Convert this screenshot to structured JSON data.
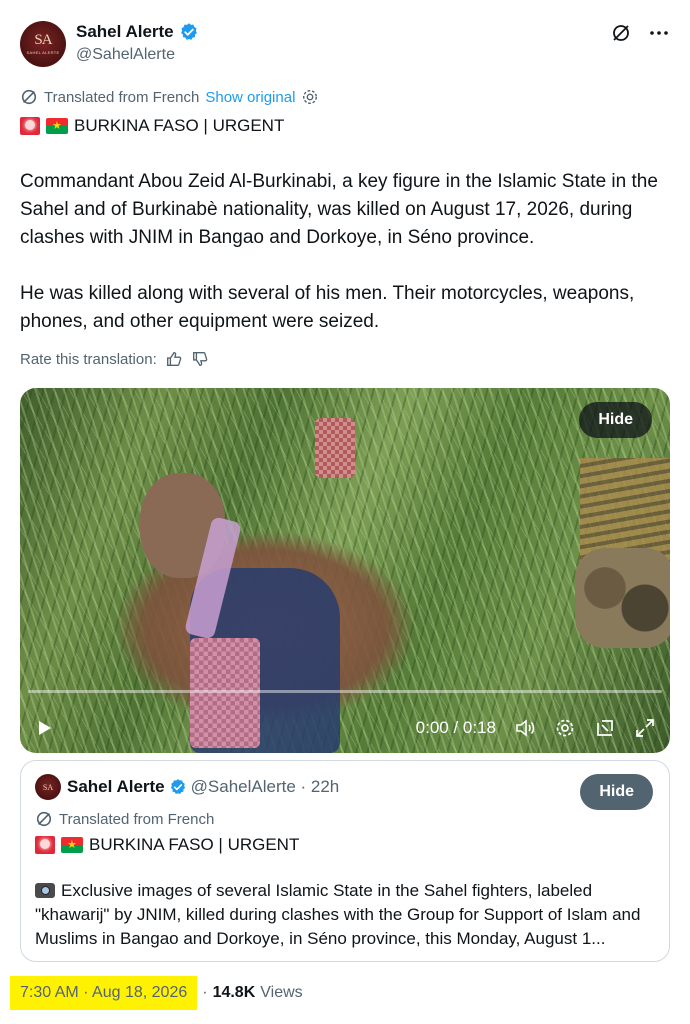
{
  "author": {
    "display_name": "Sahel Alerte",
    "handle": "@SahelAlerte",
    "avatar_monogram": "SA",
    "avatar_subtext": "SAHEL ALERTE"
  },
  "translation": {
    "label": "Translated from French",
    "show_original": "Show original"
  },
  "tweet": {
    "headline": "BURKINA FASO | URGENT",
    "paragraphs": [
      "Commandant Abou Zeid Al-Burkinabi, a key figure in the Islamic State in the Sahel and of Burkinabè nationality, was killed on August 17, 2026, during clashes with JNIM in Bangao and Dorkoye, in Séno province.",
      "He was killed along with several of his men. Their motorcycles, weapons, phones, and other equipment were seized."
    ],
    "rate_label": "Rate this translation:"
  },
  "video": {
    "hide_label": "Hide",
    "time": "0:00 / 0:18"
  },
  "quote": {
    "display_name": "Sahel Alerte",
    "meta": "@SahelAlerte · 22h",
    "translated_label": "Translated from French",
    "headline": "BURKINA FASO | URGENT",
    "text": "Exclusive images of several Islamic State in the Sahel fighters, labeled \"khawarij\" by JNIM, killed during clashes with the Group for Support of Islam and Muslims in Bangao and Dorkoye, in Séno province, this Monday, August 1...",
    "hide_label": "Hide"
  },
  "footer": {
    "timestamp": "7:30 AM · Aug 18, 2026",
    "separator": "·",
    "views_count": "14.8K",
    "views_label": "Views"
  },
  "colors": {
    "link": "#1d9bf0",
    "verified": "#1d9bf0",
    "muted": "#536471",
    "highlight": "#fff200"
  }
}
